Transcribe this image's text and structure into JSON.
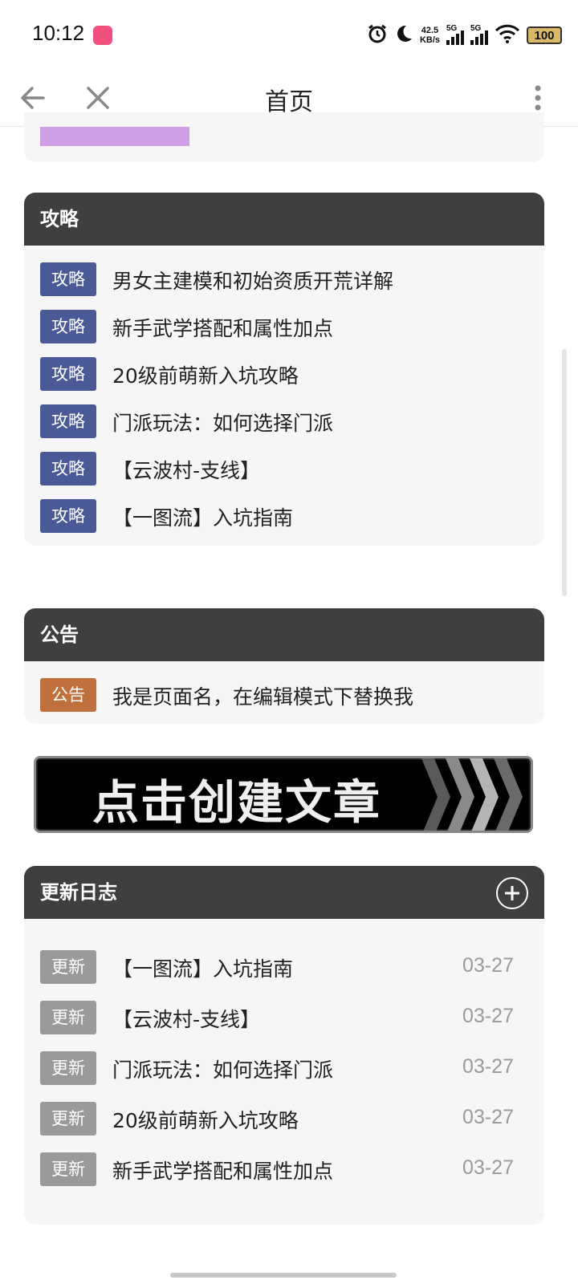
{
  "status_bar": {
    "time": "10:12",
    "speed_top": "42.5",
    "speed_bottom": "KB/s",
    "sig1_label": "5G",
    "sig2_label": "5G",
    "battery": "100"
  },
  "app_bar": {
    "title": "首页"
  },
  "guide_section": {
    "title": "攻略",
    "items": [
      {
        "tag": "攻略",
        "text": "男女主建模和初始资质开荒详解"
      },
      {
        "tag": "攻略",
        "text": "新手武学搭配和属性加点"
      },
      {
        "tag": "攻略",
        "text": "20级前萌新入坑攻略"
      },
      {
        "tag": "攻略",
        "text": "门派玩法：如何选择门派"
      },
      {
        "tag": "攻略",
        "text": "【云波村-支线】"
      },
      {
        "tag": "攻略",
        "text": "【一图流】入坑指南"
      }
    ]
  },
  "notice_section": {
    "title": "公告",
    "items": [
      {
        "tag": "公告",
        "text": "我是页面名，在编辑模式下替换我"
      }
    ]
  },
  "banner": {
    "text": "点击创建文章"
  },
  "update_section": {
    "title": "更新日志",
    "items": [
      {
        "tag": "更新",
        "text": "【一图流】入坑指南",
        "date": "03-27"
      },
      {
        "tag": "更新",
        "text": "【云波村-支线】",
        "date": "03-27"
      },
      {
        "tag": "更新",
        "text": "门派玩法：如何选择门派",
        "date": "03-27"
      },
      {
        "tag": "更新",
        "text": "20级前萌新入坑攻略",
        "date": "03-27"
      },
      {
        "tag": "更新",
        "text": "新手武学搭配和属性加点",
        "date": "03-27"
      }
    ]
  },
  "colors": {
    "header_bg": "#3f3f3f",
    "guide_tag": "#4a5a96",
    "notice_tag": "#c0703d",
    "update_tag": "#9a9a9a",
    "accent_purple": "#cf9ee3"
  }
}
